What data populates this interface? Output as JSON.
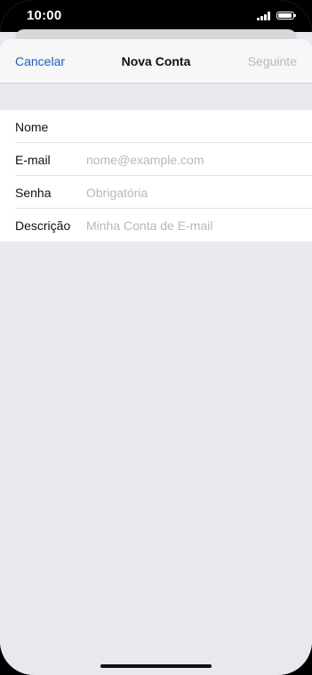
{
  "status_bar": {
    "time": "10:00",
    "signal_icon": "cellular-signal-icon",
    "battery_icon": "battery-icon"
  },
  "nav": {
    "cancel_label": "Cancelar",
    "title": "Nova Conta",
    "next_label": "Seguinte",
    "accent_color": "#1660c8",
    "disabled_color": "#b8b8bc"
  },
  "form": {
    "fields": [
      {
        "label": "Nome",
        "value": "",
        "placeholder": ""
      },
      {
        "label": "E-mail",
        "value": "",
        "placeholder": "nome@example.com"
      },
      {
        "label": "Senha",
        "value": "",
        "placeholder": "Obrigatória"
      },
      {
        "label": "Descrição",
        "value": "",
        "placeholder": "Minha Conta de E-mail"
      }
    ]
  }
}
